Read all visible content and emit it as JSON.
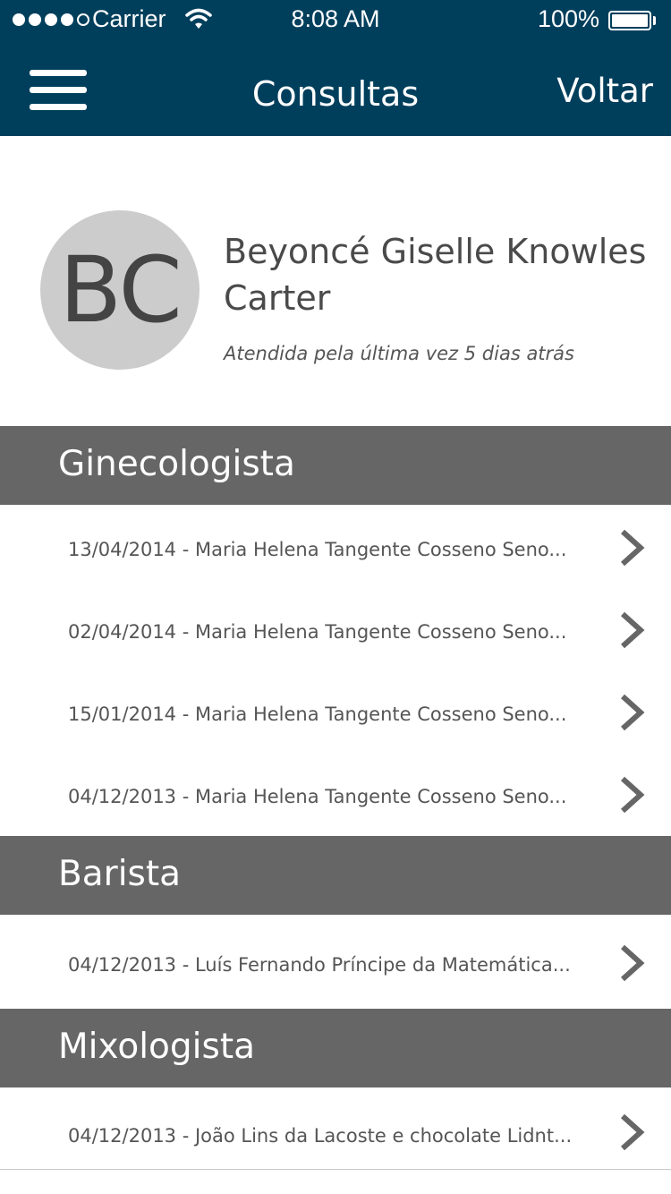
{
  "status_bar": {
    "carrier": "Carrier",
    "time": "8:08 AM",
    "battery": "100%"
  },
  "nav": {
    "title": "Consultas",
    "back_label": "Voltar",
    "menu_icon": "hamburger-menu-icon"
  },
  "profile": {
    "initials": "BC",
    "name": "Beyoncé Giselle Knowles Carter",
    "last_seen": "Atendida pela última vez 5 dias atrás"
  },
  "sections": [
    {
      "title": "Ginecologista",
      "items": [
        "13/04/2014 - Maria Helena Tangente Cosseno Seno...",
        "02/04/2014 - Maria Helena Tangente Cosseno Seno...",
        "15/01/2014 - Maria Helena Tangente Cosseno Seno...",
        "04/12/2013 - Maria Helena Tangente Cosseno Seno..."
      ]
    },
    {
      "title": "Barista",
      "items": [
        "04/12/2013 - Luís Fernando Príncipe da Matemática..."
      ]
    },
    {
      "title": "Mixologista",
      "items": [
        "04/12/2013 - João Lins da Lacoste e chocolate Lidnt..."
      ]
    }
  ],
  "colors": {
    "nav_bg": "#003f5c",
    "section_bg": "#666666",
    "avatar_bg": "#cccccc"
  }
}
